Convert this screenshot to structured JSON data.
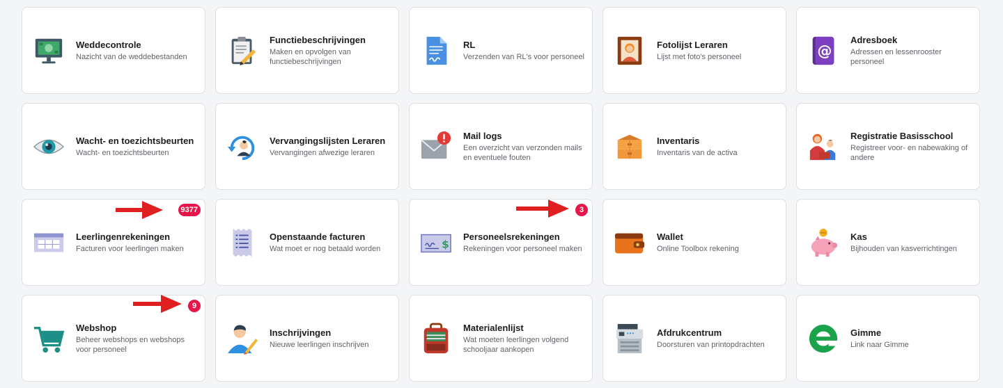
{
  "tiles": [
    {
      "title": "Weddecontrole",
      "subtitle": "Nazicht van de weddebestanden",
      "icon": "salary-monitor-icon"
    },
    {
      "title": "Functiebeschrijvingen",
      "subtitle": "Maken en opvolgen van functiebeschrijvingen",
      "icon": "clipboard-pencil-icon"
    },
    {
      "title": "RL",
      "subtitle": "Verzenden van RL's voor personeel",
      "icon": "signed-document-icon"
    },
    {
      "title": "Fotolijst Leraren",
      "subtitle": "Lijst met foto's personeel",
      "icon": "portrait-frame-icon"
    },
    {
      "title": "Adresboek",
      "subtitle": "Adressen en lessenrooster personeel",
      "icon": "address-book-icon"
    },
    {
      "title": "Wacht- en toezichtsbeurten",
      "subtitle": "Wacht- en toezichtsbeurten",
      "icon": "eye-icon"
    },
    {
      "title": "Vervangingslijsten Leraren",
      "subtitle": "Vervangingen afwezige leraren",
      "icon": "user-refresh-icon"
    },
    {
      "title": "Mail logs",
      "subtitle": "Een overzicht van verzonden mails en eventuele fouten",
      "icon": "mail-alert-icon"
    },
    {
      "title": "Inventaris",
      "subtitle": "Inventaris van de activa",
      "icon": "boxes-icon"
    },
    {
      "title": "Registratie Basisschool",
      "subtitle": "Registreer voor- en nabewaking of andere",
      "icon": "parent-child-icon"
    },
    {
      "title": "Leerlingenrekeningen",
      "subtitle": "Facturen voor leerlingen maken",
      "icon": "invoice-table-icon",
      "badge": "9377"
    },
    {
      "title": "Openstaande facturen",
      "subtitle": "Wat moet er nog betaald worden",
      "icon": "bill-list-icon"
    },
    {
      "title": "Personeelsrekeningen",
      "subtitle": "Rekeningen voor personeel maken",
      "icon": "cheque-icon",
      "badge": "3"
    },
    {
      "title": "Wallet",
      "subtitle": "Online Toolbox rekening",
      "icon": "wallet-icon"
    },
    {
      "title": "Kas",
      "subtitle": "Bijhouden van kasverrichtingen",
      "icon": "piggy-bank-icon"
    },
    {
      "title": "Webshop",
      "subtitle": "Beheer webshops en webshops voor personeel",
      "icon": "shopping-cart-icon",
      "badge": "9"
    },
    {
      "title": "Inschrijvingen",
      "subtitle": "Nieuwe leerlingen inschrijven",
      "icon": "student-pencil-icon"
    },
    {
      "title": "Materialenlijst",
      "subtitle": "Wat moeten leerlingen volgend schooljaar aankopen",
      "icon": "backpack-icon"
    },
    {
      "title": "Afdrukcentrum",
      "subtitle": "Doorsturen van printopdrachten",
      "icon": "printer-icon"
    },
    {
      "title": "Gimme",
      "subtitle": "Link naar Gimme",
      "icon": "gimme-logo-icon"
    }
  ],
  "colors": {
    "badge": "#e8154b",
    "arrow": "#e02020"
  }
}
